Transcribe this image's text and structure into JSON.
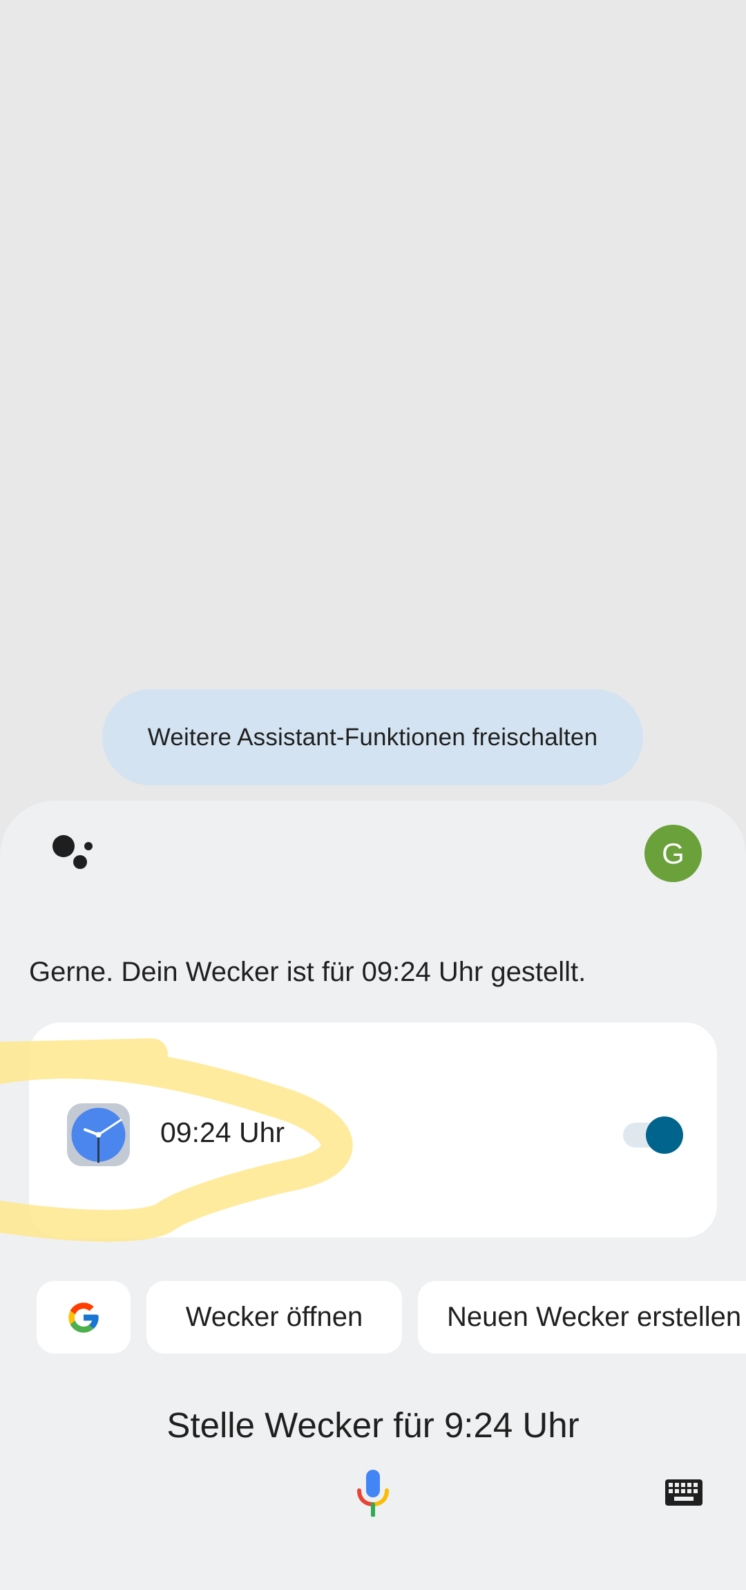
{
  "suggestion_pill": {
    "label": "Weitere Assistant-Funktionen freischalten"
  },
  "header": {
    "assistant_icon": "google-assistant-dots-icon",
    "avatar_letter": "G",
    "avatar_color": "#6aa13a"
  },
  "response": {
    "text": "Gerne. Dein Wecker ist für 09:24 Uhr gestellt."
  },
  "alarm_card": {
    "icon": "clock-app-icon",
    "time": "09:24 Uhr",
    "toggle_on": true,
    "toggle_color": "#00648d"
  },
  "chips": {
    "google_icon": "google-g-icon",
    "open_alarm": "Wecker öffnen",
    "new_alarm": "Neuen Wecker erstellen"
  },
  "query": {
    "text": "Stelle Wecker für 9:24 Uhr"
  },
  "bottom_bar": {
    "mic_icon": "microphone-icon",
    "keyboard_icon": "keyboard-icon"
  },
  "colors": {
    "background": "#e8e8e9",
    "sheet": "#eff0f2",
    "pill": "#d3e3f1",
    "highlight": "#ffe88c"
  }
}
